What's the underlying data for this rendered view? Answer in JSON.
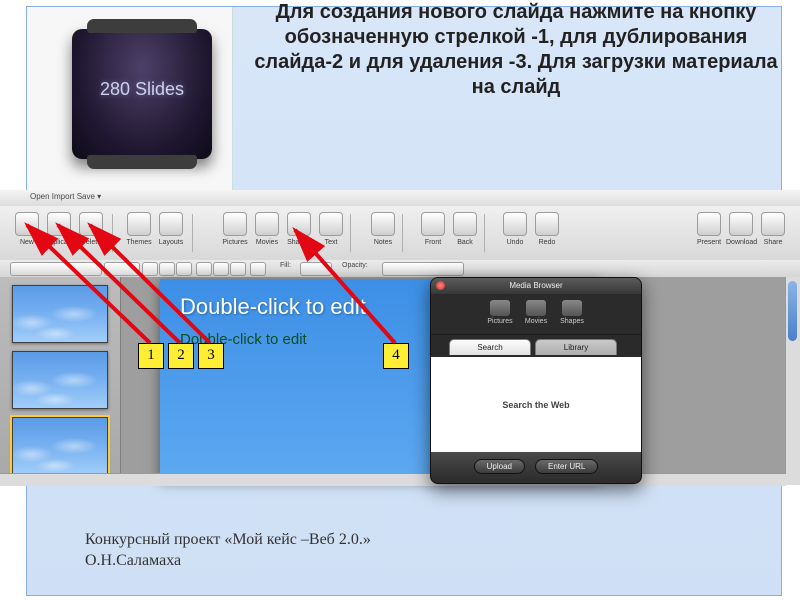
{
  "instruction": "Для создания нового слайда нажмите на кнопку обозначенную стрелкой -1, для дублирования слайда-2 и для удаления -3. Для загрузки материала на слайд",
  "brand": "280 Slides",
  "footer_line1": "Конкурсный проект «Мой кейс –Веб 2.0.»",
  "footer_line2": "О.Н.Саламаха",
  "menu_stub": "Open   Import   Save ▾",
  "toolbar": {
    "new": "New",
    "duplicate": "Duplicate",
    "delete": "Delete",
    "themes": "Themes",
    "layouts": "Layouts",
    "pictures": "Pictures",
    "movies": "Movies",
    "shapes": "Shapes",
    "text": "Text",
    "notes": "Notes",
    "front": "Front",
    "back": "Back",
    "undo": "Undo",
    "redo": "Redo",
    "present": "Present",
    "download": "Download",
    "share": "Share"
  },
  "formatbar": {
    "fill": "Fill:",
    "opacity": "Opacity:"
  },
  "slide": {
    "title": "Double-click to edit",
    "subtitle": "Double-click to edit"
  },
  "dialog": {
    "title": "Media Browser",
    "seg_pictures": "Pictures",
    "seg_movies": "Movies",
    "seg_shapes": "Shapes",
    "tab_search": "Search",
    "tab_library": "Library",
    "body": "Search the Web",
    "upload": "Upload",
    "enter_url": "Enter URL"
  },
  "callouts": {
    "c1": "1",
    "c2": "2",
    "c3": "3",
    "c4": "4"
  }
}
